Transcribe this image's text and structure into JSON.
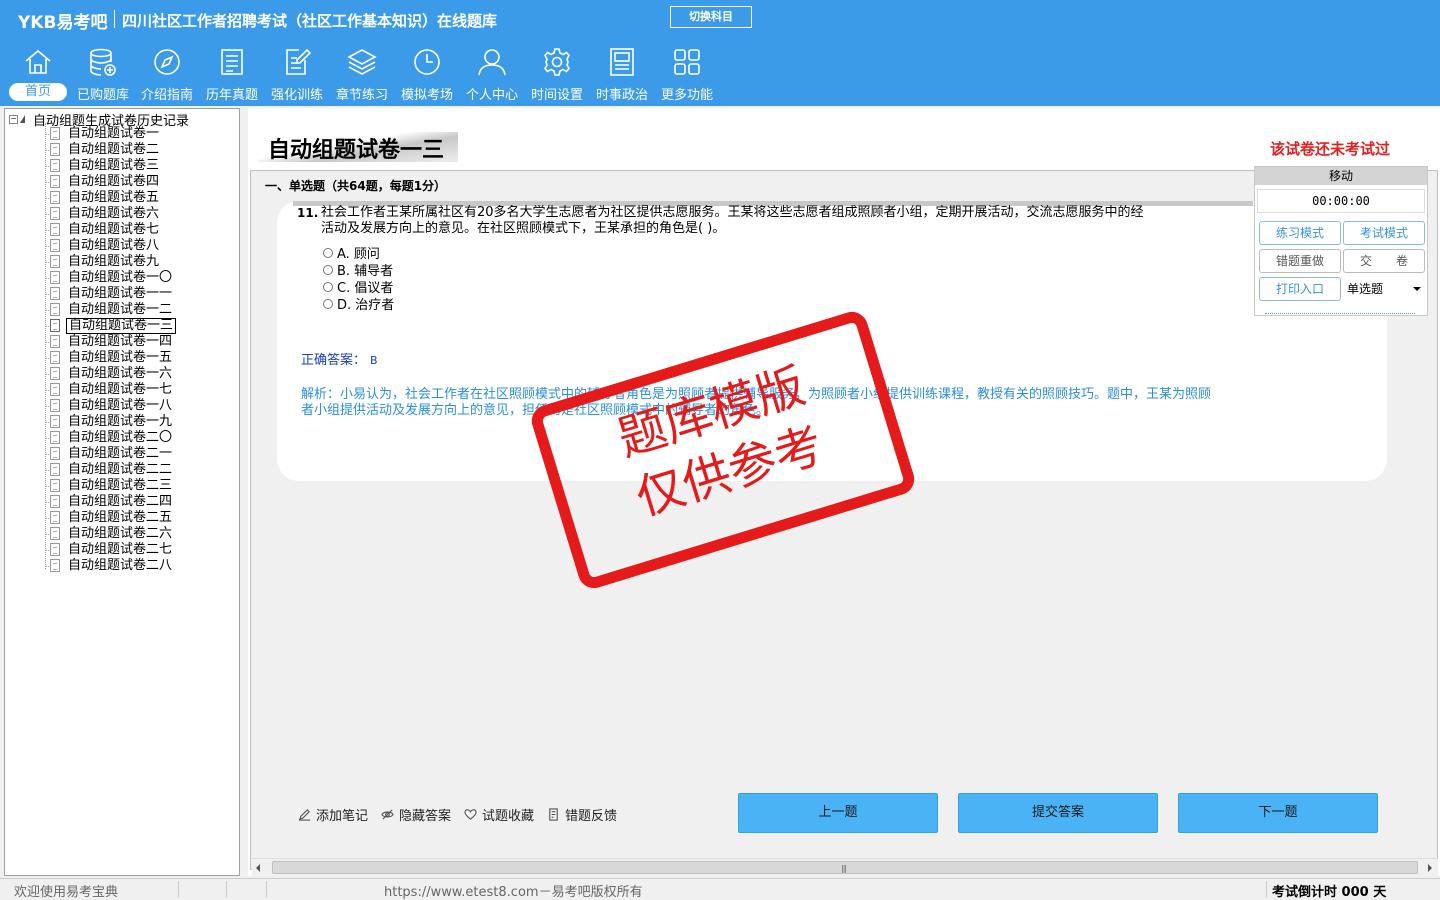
{
  "header": {
    "logo": "YKB易考吧",
    "app_title": "四川社区工作者招聘考试（社区工作基本知识）在线题库",
    "switch_subject": "切换科目"
  },
  "nav": [
    {
      "label": "首页",
      "icon": "home-icon",
      "active": true
    },
    {
      "label": "已购题库",
      "icon": "database-add-icon"
    },
    {
      "label": "介绍指南",
      "icon": "compass-icon"
    },
    {
      "label": "历年真题",
      "icon": "list-doc-icon"
    },
    {
      "label": "强化训练",
      "icon": "edit-doc-icon"
    },
    {
      "label": "章节练习",
      "icon": "layers-icon"
    },
    {
      "label": "模拟考场",
      "icon": "clock-icon"
    },
    {
      "label": "个人中心",
      "icon": "user-icon"
    },
    {
      "label": "时间设置",
      "icon": "gear-icon"
    },
    {
      "label": "时事政治",
      "icon": "newspaper-icon"
    },
    {
      "label": "更多功能",
      "icon": "grid-icon"
    }
  ],
  "tree": {
    "root": "自动组题生成试卷历史记录",
    "items": [
      "自动组题试卷一",
      "自动组题试卷二",
      "自动组题试卷三",
      "自动组题试卷四",
      "自动组题试卷五",
      "自动组题试卷六",
      "自动组题试卷七",
      "自动组题试卷八",
      "自动组题试卷九",
      "自动组题试卷一〇",
      "自动组题试卷一一",
      "自动组题试卷一二",
      "自动组题试卷一三",
      "自动组题试卷一四",
      "自动组题试卷一五",
      "自动组题试卷一六",
      "自动组题试卷一七",
      "自动组题试卷一八",
      "自动组题试卷一九",
      "自动组题试卷二〇",
      "自动组题试卷二一",
      "自动组题试卷二二",
      "自动组题试卷二三",
      "自动组题试卷二四",
      "自动组题试卷二五",
      "自动组题试卷二六",
      "自动组题试卷二七",
      "自动组题试卷二八"
    ],
    "selected_index": 12
  },
  "paper": {
    "title": "自动组题试卷一三",
    "status": "该试卷还未考试过",
    "section": "一、单选题（共64题，每题1分）"
  },
  "question": {
    "number": "11.",
    "stem_line1": "社会工作者王某所属社区有20多名大学生志愿者为社区提供志愿服务。王某将这些志愿者组成照顾者小组，定期开展活动，交流志愿服务中的经",
    "stem_line2": "活动及发展方向上的意见。在社区照顾模式下，王某承担的角色是(  )。",
    "options": [
      "A. 顾问",
      "B. 辅导者",
      "C. 倡议者",
      "D. 治疗者"
    ],
    "answer_label": "正确答案：",
    "answer": "B",
    "analysis_line1": "解析：小易认为，社会工作者在社区照顾模式中的辅导者角色是为照顾者提供辅导服务，为照顾者小组提供训练课程，教授有关的照顾技巧。题中，王某为照顾",
    "analysis_line2": "者小组提供活动及发展方向上的意见，担任的是社区照顾模式中的辅导者的角色。"
  },
  "stamp": {
    "line1": "题库模版",
    "line2": "仅供参考",
    "color": "#e51a1a"
  },
  "control": {
    "move": "移动",
    "timer": "00:00:00",
    "practice_mode": "练习模式",
    "exam_mode": "考试模式",
    "redo_wrong": "错题重做",
    "submit_paper": "交　　卷",
    "print": "打印入口",
    "question_type": "单选题"
  },
  "tools": {
    "note": "添加笔记",
    "hide_answer": "隐藏答案",
    "favorite": "试题收藏",
    "feedback": "错题反馈"
  },
  "buttons": {
    "prev": "上一题",
    "submit": "提交答案",
    "next": "下一题"
  },
  "status": {
    "welcome": "欢迎使用易考宝典",
    "copyright": "https://www.etest8.com－易考吧版权所有",
    "countdown": "考试倒计时 000 天"
  },
  "colors": {
    "header": "#3c9be8",
    "button": "#4ab3f5",
    "alert": "#e02020",
    "analysis": "#2a8ee0"
  }
}
